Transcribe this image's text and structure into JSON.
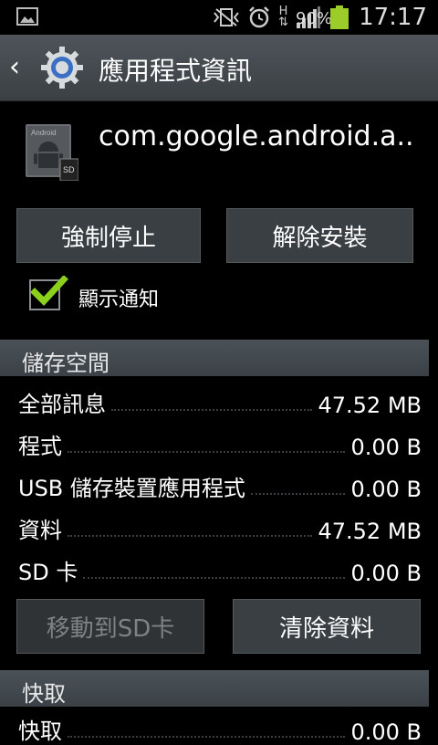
{
  "statusbar": {
    "battery_percent": "90%",
    "time": "17:17",
    "network_type": "H",
    "icons": [
      "image-icon",
      "vibrate-icon",
      "alarm-icon",
      "data-arrows-icon",
      "signal-icon",
      "battery-icon"
    ]
  },
  "actionbar": {
    "title": "應用程式資訊",
    "icons": [
      "back-icon",
      "settings-gear-icon"
    ]
  },
  "app": {
    "name": "com.google.android.a..",
    "icon_text": "Android",
    "sd_badge": "SD"
  },
  "buttons": {
    "force_stop": "強制停止",
    "uninstall": "解除安裝",
    "move_to_sd": "移動到SD卡",
    "clear_data": "清除資料"
  },
  "notifications": {
    "label": "顯示通知",
    "checked": true
  },
  "storage": {
    "header": "儲存空間",
    "rows": [
      {
        "label": "全部訊息",
        "value": "47.52 MB"
      },
      {
        "label": "程式",
        "value": "0.00 B"
      },
      {
        "label": "USB 儲存裝置應用程式",
        "value": "0.00 B"
      },
      {
        "label": "資料",
        "value": "47.52 MB"
      },
      {
        "label": "SD 卡",
        "value": "0.00 B"
      }
    ]
  },
  "cache": {
    "header": "快取",
    "rows": [
      {
        "label": "快取",
        "value": "0.00 B"
      }
    ]
  },
  "colors": {
    "accent_green": "#8ad01d",
    "battery_green": "#9ccc2a",
    "actionbar": "#464c51",
    "button": "#3a3f43"
  }
}
